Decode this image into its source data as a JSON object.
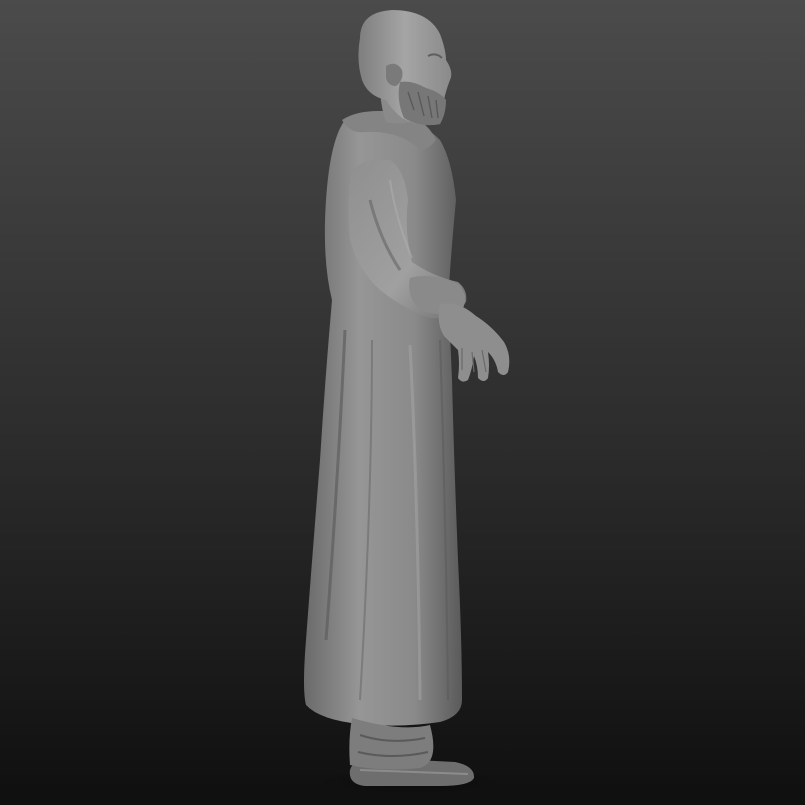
{
  "scene": {
    "subject": "sculpted-robed-figure",
    "view": "side-profile",
    "colors": {
      "background_top": "#4b4b4b",
      "background_bottom": "#0f0f0f",
      "material_light": "#9a9a9a",
      "material_mid": "#767676",
      "material_dark": "#4a4a4a"
    }
  }
}
